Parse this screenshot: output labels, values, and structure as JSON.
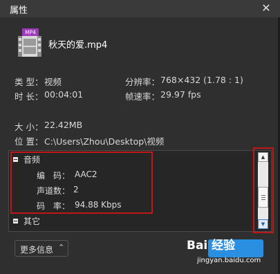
{
  "window": {
    "title": "属性"
  },
  "file": {
    "name": "秋天的爱.mp4",
    "badge": "MP4"
  },
  "info": {
    "type_label": "类 型：",
    "type_value": "视频",
    "resolution_label": "分辨率：",
    "resolution_value": "768×432 (1.78 : 1)",
    "duration_label": "时 长：",
    "duration_value": "00:04:01",
    "framerate_label": "帧速率：",
    "framerate_value": "29.97 fps",
    "size_label": "大 小：",
    "size_value": "22.42MB",
    "location_label": "位 置：",
    "location_value": "C:\\Users\\Zhou\\Desktop\\视频"
  },
  "panel": {
    "audio_header": "音频",
    "codec_label": "编　码：",
    "codec_value": "AAC2",
    "channels_label": "声道数：",
    "channels_value": "2",
    "bitrate_label": "码　率：",
    "bitrate_value": "94.88 Kbps",
    "other_header": "其它"
  },
  "buttons": {
    "more_info": "更多信息"
  },
  "watermark": {
    "main": "Bai 经验",
    "sub": "jingyan.baidu.com"
  },
  "colors": {
    "highlight": "#c01818",
    "accent": "#2a8fe0"
  }
}
